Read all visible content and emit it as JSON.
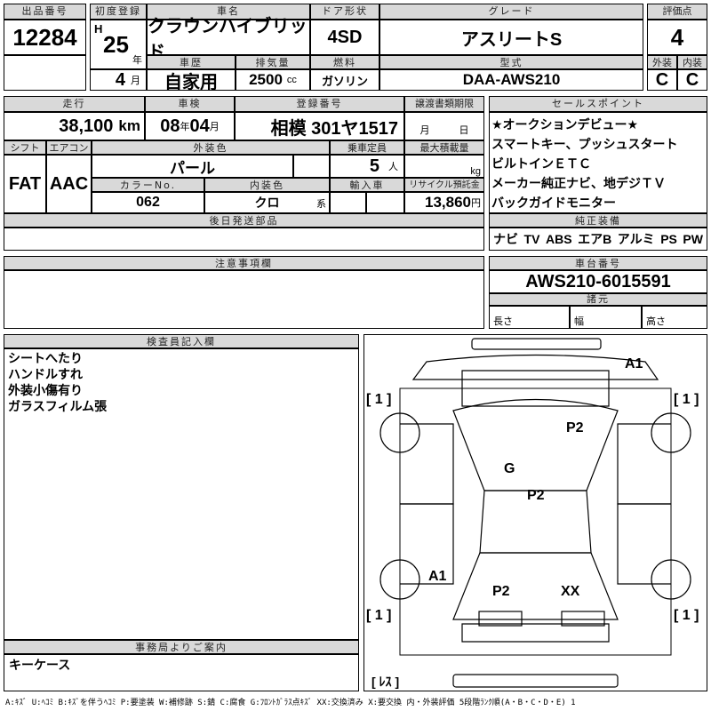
{
  "lot": {
    "label": "出品番号",
    "value": "12284"
  },
  "first_reg": {
    "label": "初度登録",
    "era": "H",
    "year": "25",
    "year_unit": "年",
    "month": "4",
    "month_unit": "月"
  },
  "car_name": {
    "label": "車名",
    "value": "クラウンハイブリッド"
  },
  "door": {
    "label": "ドア形状",
    "value": "4SD"
  },
  "grade": {
    "label": "グレード",
    "value": "アスリートS"
  },
  "history": {
    "label": "車歴",
    "value": "自家用"
  },
  "displacement": {
    "label": "排気量",
    "value": "2500",
    "unit": "cc"
  },
  "fuel": {
    "label": "燃料",
    "value": "ガソリン"
  },
  "model": {
    "label": "型式",
    "value": "DAA-AWS210"
  },
  "score": {
    "label": "評価点",
    "value": "4",
    "ext_label": "外装",
    "ext": "C",
    "int_label": "内装",
    "int": "C"
  },
  "mileage": {
    "label": "走行",
    "value": "38,100",
    "unit": "km"
  },
  "inspection": {
    "label": "車検",
    "year": "08",
    "year_unit": "年",
    "month": "04",
    "month_unit": "月"
  },
  "plate": {
    "label": "登録番号",
    "value": "相模 301ヤ1517"
  },
  "transfer": {
    "label": "譲渡書類期限",
    "month_unit": "月",
    "day_unit": "日"
  },
  "shift": {
    "label": "シフト",
    "value": "FAT"
  },
  "aircon": {
    "label": "エアコン",
    "value": "AAC"
  },
  "ext_color": {
    "label": "外装色",
    "value": "パール"
  },
  "capacity": {
    "label": "乗車定員",
    "value": "5",
    "unit": "人"
  },
  "max_load": {
    "label": "最大積載量",
    "unit": "kg"
  },
  "color_no": {
    "label": "カラーNo.",
    "value": "062"
  },
  "int_color": {
    "label": "内装色",
    "value": "クロ",
    "unit": "系"
  },
  "import": {
    "label": "輸入車"
  },
  "recycle": {
    "label": "リサイクル預託金",
    "value": "13,860",
    "unit": "円"
  },
  "later_parts": {
    "label": "後日発送部品"
  },
  "sale_points": {
    "label": "セールスポイント",
    "items": [
      "★オークションデビュー★",
      "スマートキー、プッシュスタート",
      "ビルトインＥＴＣ",
      "メーカー純正ナビ、地デジＴＶ",
      "バックガイドモニター"
    ]
  },
  "equipment": {
    "label": "純正装備",
    "items": [
      "ナビ",
      "TV",
      "ABS",
      "エアB",
      "アルミ",
      "PS",
      "PW"
    ]
  },
  "notes": {
    "label": "注意事項欄"
  },
  "chassis": {
    "label": "車台番号",
    "value": "AWS210-6015591"
  },
  "specs": {
    "label": "諸元",
    "length": "長さ",
    "width": "幅",
    "height": "高さ"
  },
  "inspector": {
    "label": "検査員記入欄",
    "lines": [
      "シートへたり",
      "ハンドルすれ",
      "外装小傷有り",
      "ガラスフィルム張"
    ]
  },
  "office": {
    "label": "事務局よりご案内",
    "value": "キーケース"
  },
  "diagram": {
    "marks": [
      "A1",
      "[ 1 ]",
      "[ 1 ]",
      "P2",
      "G",
      "P2",
      "A1",
      "P2",
      "XX",
      "[ 1 ]",
      "[ 1 ]"
    ],
    "less": "[ ﾚｽ ]"
  },
  "legend": "A:ｷｽﾞ U:ﾍｺﾐ B:ｷｽﾞを伴うﾍｺﾐ P:要塗装 W:補修跡 S:錆 C:腐食 G:ﾌﾛﾝﾄｶﾞﾗｽ点ｷｽﾞ XX:交換済み X:要交換 内・外装評価 5段階ﾗﾝｸ順(A・B・C・D・E) 1"
}
